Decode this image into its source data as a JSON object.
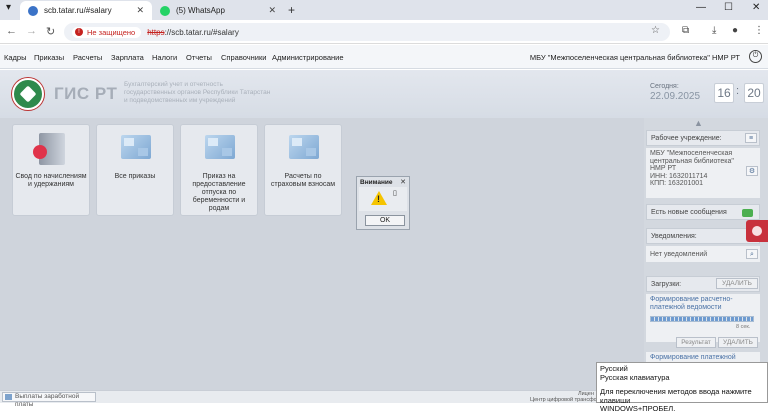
{
  "browser": {
    "tabs": [
      {
        "title": "scb.tatar.ru/#salary",
        "active": true
      },
      {
        "title": "(5) WhatsApp",
        "active": false
      }
    ],
    "new_tab": "+",
    "url_insecure_label": "Не защищено",
    "url_protocol": "https",
    "url_rest": "://scb.tatar.ru/#salary"
  },
  "menu": {
    "items": [
      "Кадры",
      "Приказы",
      "Расчеты",
      "Зарплата",
      "Налоги",
      "Отчеты",
      "Справочники",
      "Администрирование"
    ],
    "organization": "МБУ \"Межпоселенческая центральная библиотека\" НМР РТ"
  },
  "header": {
    "brand": "ГИС РТ",
    "subtitle_lines": [
      "Бухгалтерский учет и отчетность",
      "государственных органов Республики Татарстан",
      "и подведомственных им учреждений"
    ],
    "today_label": "Сегодня:",
    "today_date": "22.09.2025",
    "hours": "16",
    "minutes": "20"
  },
  "tiles": [
    {
      "label": "Свод по начислениям и удержаниям",
      "icon": "book-icon"
    },
    {
      "label": "Все приказы",
      "icon": "cubes-icon"
    },
    {
      "label": "Приказ на предоставление отпуска по беременности и родам",
      "icon": "cubes-icon"
    },
    {
      "label": "Расчеты по страховым взносам",
      "icon": "cubes-icon"
    }
  ],
  "dialog": {
    "title": "Внимание",
    "close": "✕",
    "ok_label": "OK"
  },
  "right_panel": {
    "workplace_header": "Рабочее учреждение:",
    "workplace_lines": [
      "МБУ \"Межпоселенческая",
      "центральная библиотека\"",
      "НМР РТ",
      "ИНН: 1632011714",
      "КПП: 163201001"
    ],
    "messages_header": "Есть новые сообщения",
    "notifications_header": "Уведомления:",
    "notifications_value": "Нет уведомлений",
    "downloads_header": "Загрузки:",
    "delete_label": "УДАЛИТЬ",
    "download_item_lines": [
      "Формирование расчетно-",
      "платежной ведомости"
    ],
    "download_progress": 1.0,
    "download_time": "8 сек.",
    "result_label": "Результат",
    "delete_label_2": "УДАЛИТЬ",
    "download_item2": "Формирование платежной"
  },
  "ime_tooltip": {
    "line1": "Русский",
    "line2": "Русская клавиатура",
    "line3": "Для переключения методов ввода нажмите клавиши",
    "line4": "WINDOWS+ПРОБЕЛ."
  },
  "bottom": {
    "task_label": "Выплаты заработной платы",
    "footer_line1": "Лицен",
    "footer_line2": "Центр цифровой трансфо"
  }
}
